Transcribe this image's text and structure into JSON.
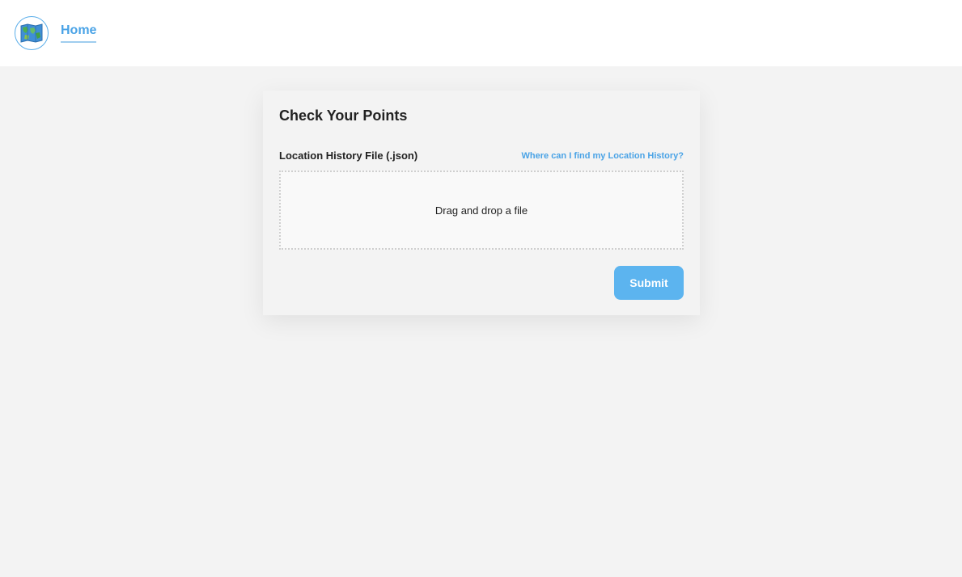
{
  "header": {
    "logo_icon": "map-icon",
    "nav": [
      {
        "label": "Home",
        "active": true
      }
    ]
  },
  "form": {
    "title": "Check Your Points",
    "field_label": "Location History File (.json)",
    "help_link": "Where can I find my Location History?",
    "dropzone_text": "Drag and drop a file",
    "submit_label": "Submit"
  },
  "colors": {
    "accent": "#4aa3e6",
    "button": "#5cb4ef",
    "page_background": "#f3f3f3",
    "header_background": "#ffffff"
  }
}
